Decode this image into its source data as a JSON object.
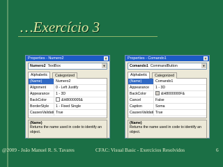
{
  "slide": {
    "title": "…Exercício 3",
    "footer": {
      "author": "@2009 - João Manuel R. S. Tavares",
      "course": "CFAC: Visual Basic - Exercícios Resolvidos",
      "page": "6"
    }
  },
  "panels": [
    {
      "title": "Properties - Numero2",
      "object_name": "Numero2",
      "object_type": "TextBox",
      "tabs": [
        "Alphabetic",
        "Categorized"
      ],
      "rows": [
        {
          "key": "(Name)",
          "value": "Numero2"
        },
        {
          "key": "Alignment",
          "value": "0 - Left Justify"
        },
        {
          "key": "Appearance",
          "value": "1 - 3D"
        },
        {
          "key": "BackColor",
          "value": "&H8000005&"
        },
        {
          "key": "BorderStyle",
          "value": "1 - Fixed Single"
        },
        {
          "key": "CausesValidation",
          "value": "True"
        }
      ],
      "description_name": "(Name)",
      "description_text": "Returns the name used in code to identify an object."
    },
    {
      "title": "Properties - Comando1",
      "object_name": "Comando1",
      "object_type": "CommandButton",
      "tabs": [
        "Alphabetic",
        "Categorized"
      ],
      "rows": [
        {
          "key": "(Name)",
          "value": "Comando1"
        },
        {
          "key": "Appearance",
          "value": "1 - 3D"
        },
        {
          "key": "BackColor",
          "value": "&H8000000F&"
        },
        {
          "key": "Cancel",
          "value": "False"
        },
        {
          "key": "Caption",
          "value": "Soma"
        },
        {
          "key": "CausesValidation",
          "value": "True"
        }
      ],
      "description_name": "(Name)",
      "description_text": "Returns the name used in code to identify an object."
    }
  ],
  "colors": {
    "background": "#1B6F45",
    "title": "#D9E6A0",
    "titlebar": "#1C5BC6"
  },
  "icons": {
    "close": "close-icon",
    "dropdown": "chevron-down-icon"
  }
}
